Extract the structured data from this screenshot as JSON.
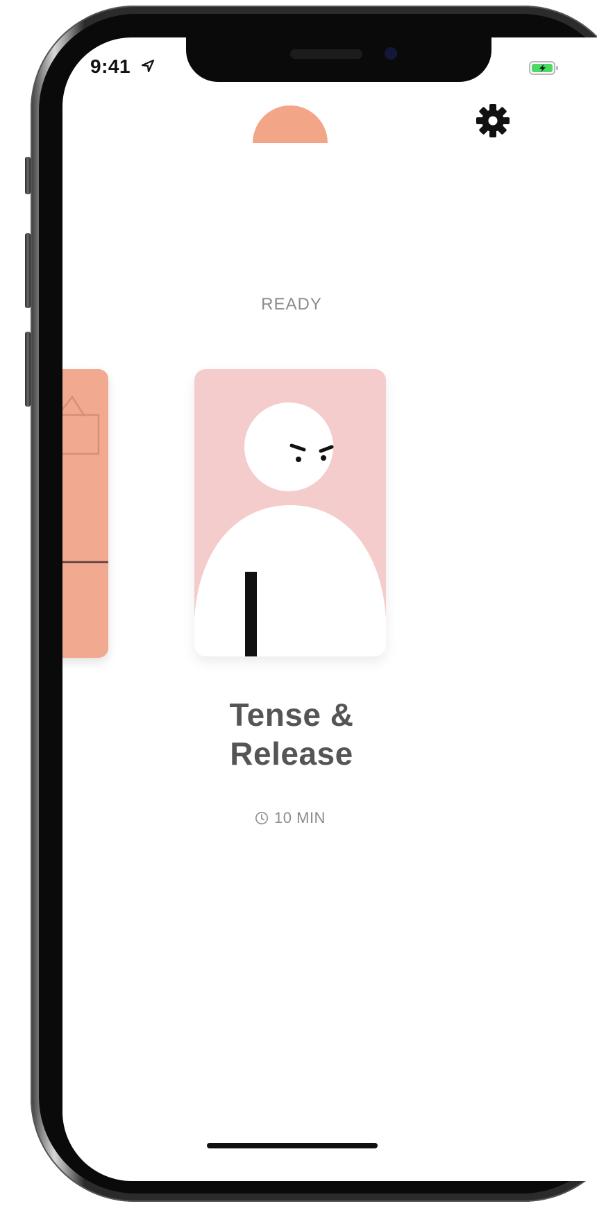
{
  "status_bar": {
    "time": "9:41"
  },
  "session": {
    "status": "READY",
    "title": "Tense &\nRelease",
    "duration": "10 MIN"
  },
  "icons": {
    "settings": "gear-icon",
    "location": "location-arrow-icon",
    "battery": "battery-charging-icon",
    "clock": "clock-icon"
  },
  "colors": {
    "accent": "#f2a587",
    "prev_card": "#f1aa8f",
    "main_card": "#f5cccc",
    "title_text": "#555555",
    "muted_text": "#8c8c8c",
    "battery_green": "#4cd964"
  }
}
